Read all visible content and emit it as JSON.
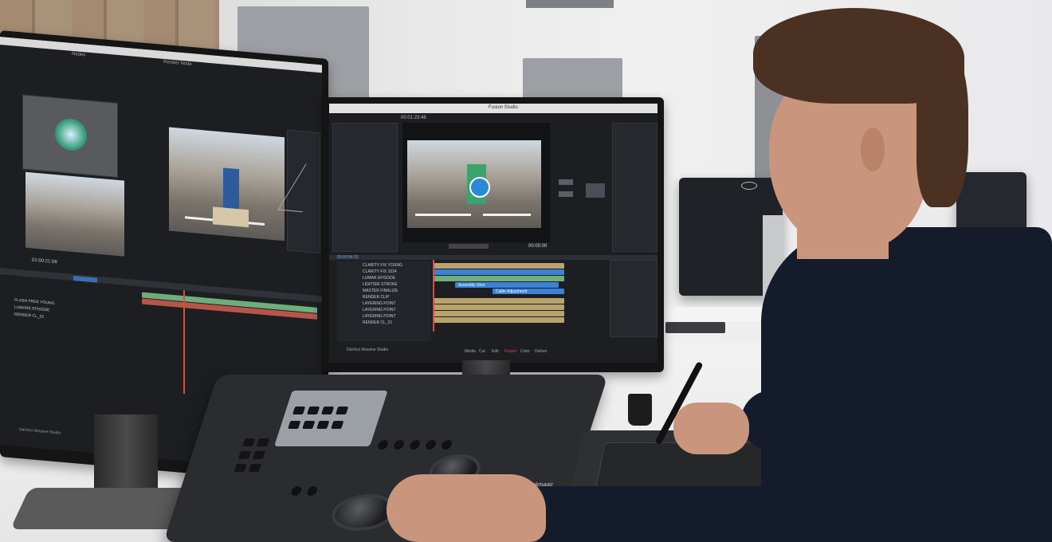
{
  "left_monitor": {
    "menu_tabs": [
      "Nodes",
      "Render Node"
    ],
    "timecode": "01:00:21:08",
    "tracks": [
      "FLASH FREE YOUNG",
      "LUMARE EPISODE",
      "RENDER CL_01"
    ],
    "status_bar": "DaVinci Resolve Studio"
  },
  "center_monitor": {
    "app_title": "Fusion Studio",
    "timecode_top": "00:01:23:48",
    "timecode_transport": "00:00:00",
    "timeline_timecode": "00:00:54:23",
    "track_labels": [
      "CLARITY FIX YOUNG",
      "CLARITY FIX 1024",
      "LUMAR EPISODE",
      "LIGHTER STROKE",
      "MASTER FINALIZE",
      "RENDER CLIP",
      "LAYERING POINT",
      "LAYERING POINT",
      "LAYERING POINT",
      "RENDER CL_01"
    ],
    "clip_labels": [
      "Assembly Shot",
      "Cable Adjustment"
    ],
    "footer": "DaVinci Resolve Studio",
    "page_tabs": [
      "Media",
      "Cut",
      "Edit",
      "Fusion",
      "Color",
      "Deliver"
    ]
  },
  "panel_brand": "Blackmagic",
  "colors": {
    "accent_blue": "#3b82d6",
    "clip_tan": "#b9a36c",
    "clip_green": "#6fae7a",
    "playhead_red": "#e04a3a"
  }
}
